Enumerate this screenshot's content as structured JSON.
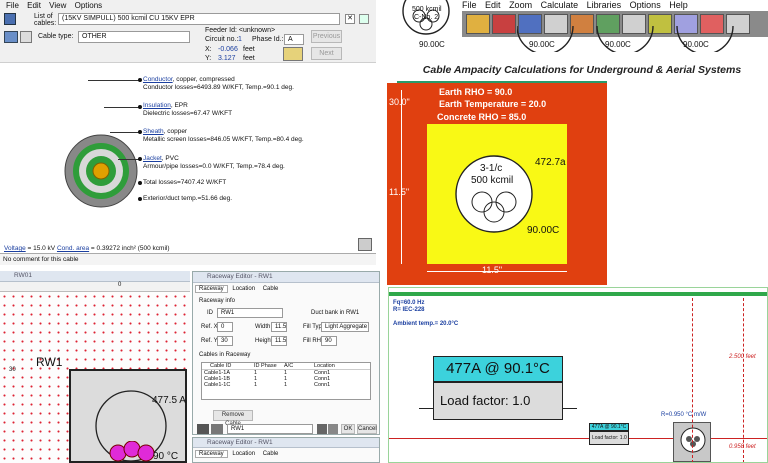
{
  "panel1": {
    "menu": [
      "File",
      "Edit",
      "View",
      "Options"
    ],
    "list_label_1": "List of",
    "list_label_2": "cables:",
    "cable_select": "(15KV SIMPULL) 500 kcmil CU 15KV EPR",
    "cable_type_label": "Cable type:",
    "cable_type_value": "OTHER",
    "feeder_id": "Feeder Id: <unknown>",
    "circuit_label": "Circuit no.:",
    "circuit_value": "1",
    "phase_label": "Phase Id.:",
    "phase_value": "A",
    "x_label": "X:",
    "x_value": "-0.066",
    "x_unit": "feet",
    "y_label": "Y:",
    "y_value": "3.127",
    "y_unit": "feet",
    "prev_button": "Previous",
    "next_button": "Next",
    "annotations": [
      {
        "link": "Conductor",
        "rest": ", copper, compressed",
        "line2": "Conductor losses=6493.89 W/KFT, Temp.=90.1 deg."
      },
      {
        "link": "Insulation",
        "rest": ", EPR",
        "line2": "Dielectric losses=67.47 W/KFT"
      },
      {
        "link": "Sheath",
        "rest": ", copper",
        "line2": "Metallic screen losses=846.05 W/KFT, Temp.=80.4 deg."
      },
      {
        "link": "Jacket",
        "rest": ", PVC",
        "line2": "Armour/pipe losses=0.0 W/KFT, Temp.=78.4 deg."
      }
    ],
    "total_losses": "Total losses=7407.42 W/KFT",
    "exterior_temp": "Exterior/duct temp.=51.66 deg.",
    "voltage_link": "Voltage",
    "voltage_text": " = 15.0 kV  ",
    "cond_area_link": "Cond. area",
    "cond_area_text": " = 0.39272 inch² (500 kcmil)",
    "comment": "No comment for this cable"
  },
  "panel2": {
    "menu": [
      "File",
      "Edit",
      "Zoom",
      "Calculate",
      "Libraries",
      "Options",
      "Help"
    ],
    "headline": "Cable Ampacity Calculations for Underground & Aerial Systems",
    "mini_labels": [
      "500 kcmil",
      "C-No. 2",
      "90.00C",
      "90.00C",
      "90.00C",
      "90.00C"
    ],
    "earth_rho": "Earth RHO = 90.0",
    "earth_temp": "Earth Temperature = 20.0",
    "concrete_rho": "Concrete RHO = 85.0",
    "dim_top": "30.0\"",
    "dim_side": "11.5\"",
    "dim_bottom": "11.5\"",
    "cable_label_1": "3-1/c",
    "cable_label_2": "500 kcmil",
    "ampacity": "472.7a",
    "temperature": "90.00C"
  },
  "panel3": {
    "window_title": "RW01",
    "ruler_mark": "0",
    "rw_label": "RW1",
    "y_mark": "30",
    "ampacity": "477.5 A",
    "temperature": "90 °C",
    "editor_title": "Raceway Editor - RW1",
    "tabs": [
      "Raceway",
      "Location",
      "Cable"
    ],
    "group_info": "Raceway info",
    "id_label": "ID",
    "id_value": "RW1",
    "id_note": "Duct bank in RW1",
    "ref_x_label": "Ref. X",
    "ref_x_value": "0",
    "width_label": "Width",
    "width_value": "11.5",
    "fill_type_label": "Fill Type",
    "fill_type_value": "Light Aggregate",
    "ref_y_label": "Ref. Y",
    "ref_y_value": "30",
    "height_label": "Height",
    "height_value": "11.5",
    "fill_rho_label": "Fill RHO",
    "fill_rho_value": "90",
    "cables_group": "Cables in Raceway",
    "cable_columns": [
      "Cable ID",
      "ID Phase",
      "A/C",
      "Location"
    ],
    "cable_rows": [
      [
        "Cable1-1A",
        "1",
        "1",
        "Conn1"
      ],
      [
        "Cable1-1B",
        "1",
        "1",
        "Conn1"
      ],
      [
        "Cable1-1C",
        "1",
        "1",
        "Conn1"
      ]
    ],
    "remove_button": "Remove Cable",
    "bottom_select": "RW1",
    "ok_button": "OK",
    "cancel_button": "Cancel",
    "editor2_title": "Raceway Editor - RW1",
    "tabs2": [
      "Raceway",
      "Location",
      "Cable"
    ]
  },
  "panel4": {
    "freq": "Fq=60.0 Hz",
    "standard": "R= IEC-228",
    "ambient": "Ambient temp.= 20.0°C",
    "ampacity": "477A @ 90.1°C",
    "load_factor": "Load factor: 1.0",
    "mini_amp": "477A @ 90.1°C",
    "mini_load": "Load factor: 1.0",
    "rho_label": "R=0.950 °C m/W",
    "dim_1": "2.500 feet",
    "dim_2": "0.958 feet",
    "colors": {
      "accent": "#3cd2dc",
      "green": "#2fa84a"
    }
  }
}
